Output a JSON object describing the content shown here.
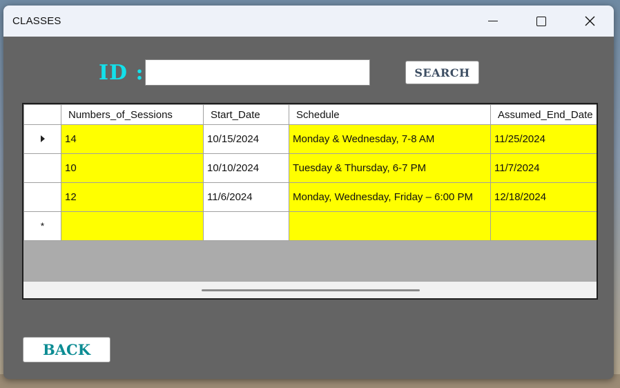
{
  "window": {
    "title": "CLASSES"
  },
  "caption": {
    "minimize": "minimize",
    "maximize": "maximize",
    "close": "close"
  },
  "search": {
    "label": "ID :",
    "value": "",
    "button_label": "SEARCH"
  },
  "grid": {
    "columns": [
      "Numbers_of_Sessions",
      "Start_Date",
      "Schedule",
      "Assumed_End_Date"
    ],
    "rows": [
      [
        "14",
        "10/15/2024",
        "Monday & Wednesday, 7-8 AM",
        "11/25/2024"
      ],
      [
        "10",
        "10/10/2024",
        "Tuesday & Thursday, 6-7 PM",
        "11/7/2024"
      ],
      [
        "12",
        "11/6/2024",
        "Monday, Wednesday, Friday – 6:00 PM",
        "12/18/2024"
      ]
    ],
    "new_row_marker": "*",
    "highlight_color": "#ffff00"
  },
  "footer": {
    "back_label": "BACK"
  }
}
